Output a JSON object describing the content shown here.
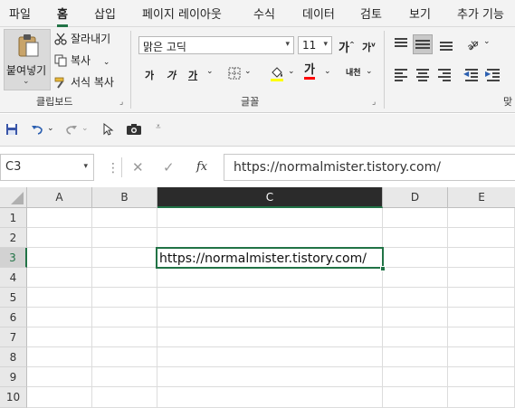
{
  "menu": {
    "tabs": [
      "파일",
      "홈",
      "삽입",
      "페이지 레이아웃",
      "수식",
      "데이터",
      "검토",
      "보기",
      "추가 기능"
    ],
    "active_tab": "홈"
  },
  "ribbon": {
    "clipboard": {
      "paste_label": "붙여넣기",
      "cut_label": "잘라내기",
      "copy_label": "복사",
      "format_painter_label": "서식 복사",
      "group_label": "클립보드"
    },
    "font": {
      "font_name": "맑은 고딕",
      "font_size": "11",
      "grow_label": "가",
      "shrink_label": "가",
      "bold_label": "가",
      "italic_label": "가",
      "underline_label": "가",
      "font_color_label": "가",
      "phonetic_label": "내천",
      "group_label": "글꼴",
      "fill_color": "#ffff00",
      "font_color": "#ff0000"
    },
    "alignment": {
      "group_label_partial": "맞"
    }
  },
  "formula_bar": {
    "name_box": "C3",
    "fx_label": "fx",
    "value": "https://normalmister.tistory.com/"
  },
  "grid": {
    "columns": [
      "A",
      "B",
      "C",
      "D",
      "E"
    ],
    "rows": [
      "1",
      "2",
      "3",
      "4",
      "5",
      "6",
      "7",
      "8",
      "9",
      "10"
    ],
    "selected_column": "C",
    "selected_row": "3",
    "active_cell_value": "https://normalmister.tistory.com/"
  },
  "colors": {
    "accent": "#217346"
  }
}
